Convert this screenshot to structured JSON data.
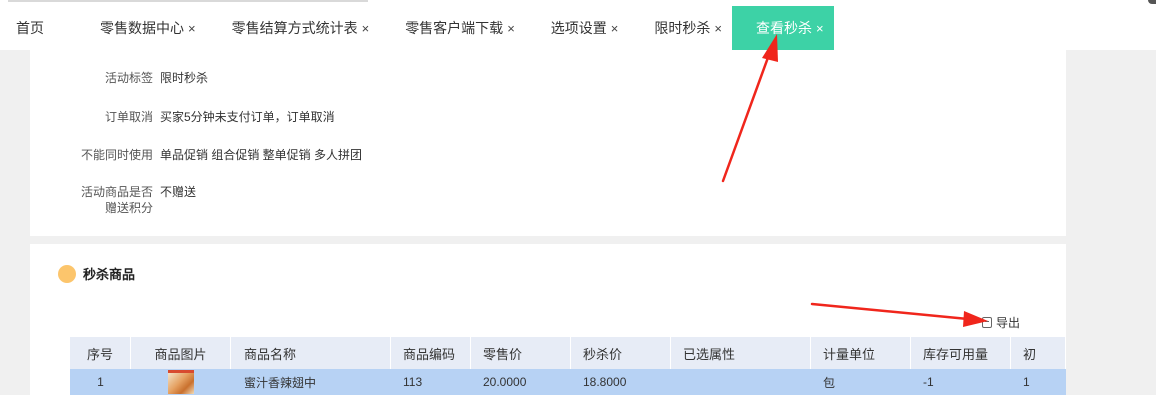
{
  "tabs": [
    {
      "label": "首页",
      "closable": false,
      "active": false
    },
    {
      "label": "零售数据中心",
      "closable": true,
      "active": false
    },
    {
      "label": "零售结算方式统计表",
      "closable": true,
      "active": false
    },
    {
      "label": "零售客户端下载",
      "closable": true,
      "active": false
    },
    {
      "label": "选项设置",
      "closable": true,
      "active": false
    },
    {
      "label": "限时秒杀",
      "closable": true,
      "active": false
    },
    {
      "label": "查看秒杀",
      "closable": true,
      "active": true
    }
  ],
  "close_glyph": "×",
  "details": [
    {
      "label": "活动标签",
      "value": "限时秒杀"
    },
    {
      "label": "订单取消",
      "value": "买家5分钟未支付订单，订单取消"
    },
    {
      "label": "不能同时使用",
      "value": "单品促销 组合促销 整单促销 多人拼团"
    },
    {
      "label": "活动商品是否赠送积分",
      "value": "不赠送"
    }
  ],
  "section": {
    "title": "秒杀商品",
    "export_label": "导出"
  },
  "table": {
    "columns": [
      "序号",
      "商品图片",
      "商品名称",
      "商品编码",
      "零售价",
      "秒杀价",
      "已选属性",
      "计量单位",
      "库存可用量",
      "初"
    ],
    "rows": [
      {
        "index": "1",
        "name": "蜜汁香辣翅中",
        "code": "113",
        "retail_price": "20.0000",
        "flash_price": "18.8000",
        "attrs": "",
        "unit": "包",
        "stock": "-1",
        "extra": "1"
      }
    ]
  },
  "colors": {
    "accent": "#3dd2a6",
    "section_dot": "#fcc56c",
    "row_highlight": "#b7d2f4",
    "header_bg": "#e7ecf6",
    "annotation_arrow": "#f0261c"
  },
  "icons": {
    "close": "close-icon",
    "export": "export-icon",
    "section": "section-dot-icon"
  }
}
